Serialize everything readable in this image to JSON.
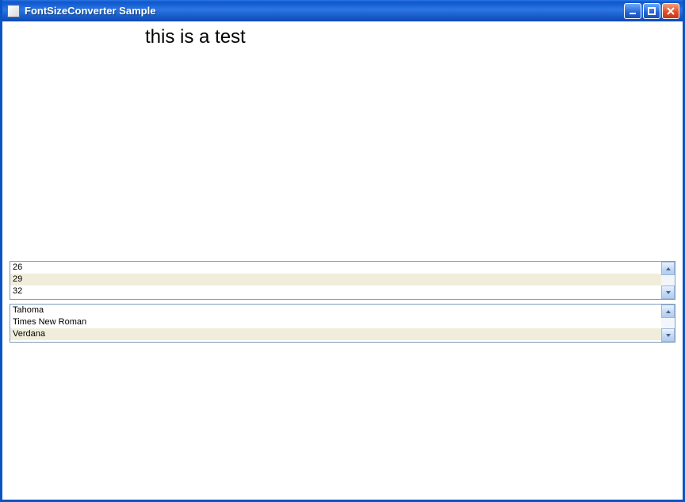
{
  "window": {
    "title": "FontSizeConverter Sample"
  },
  "demo_text": "this is a test",
  "size_list": {
    "selected_index": 1,
    "items": [
      "26",
      "29",
      "32"
    ]
  },
  "font_list": {
    "selected_index": 2,
    "items": [
      "Tahoma",
      "Times New Roman",
      "Verdana"
    ]
  }
}
